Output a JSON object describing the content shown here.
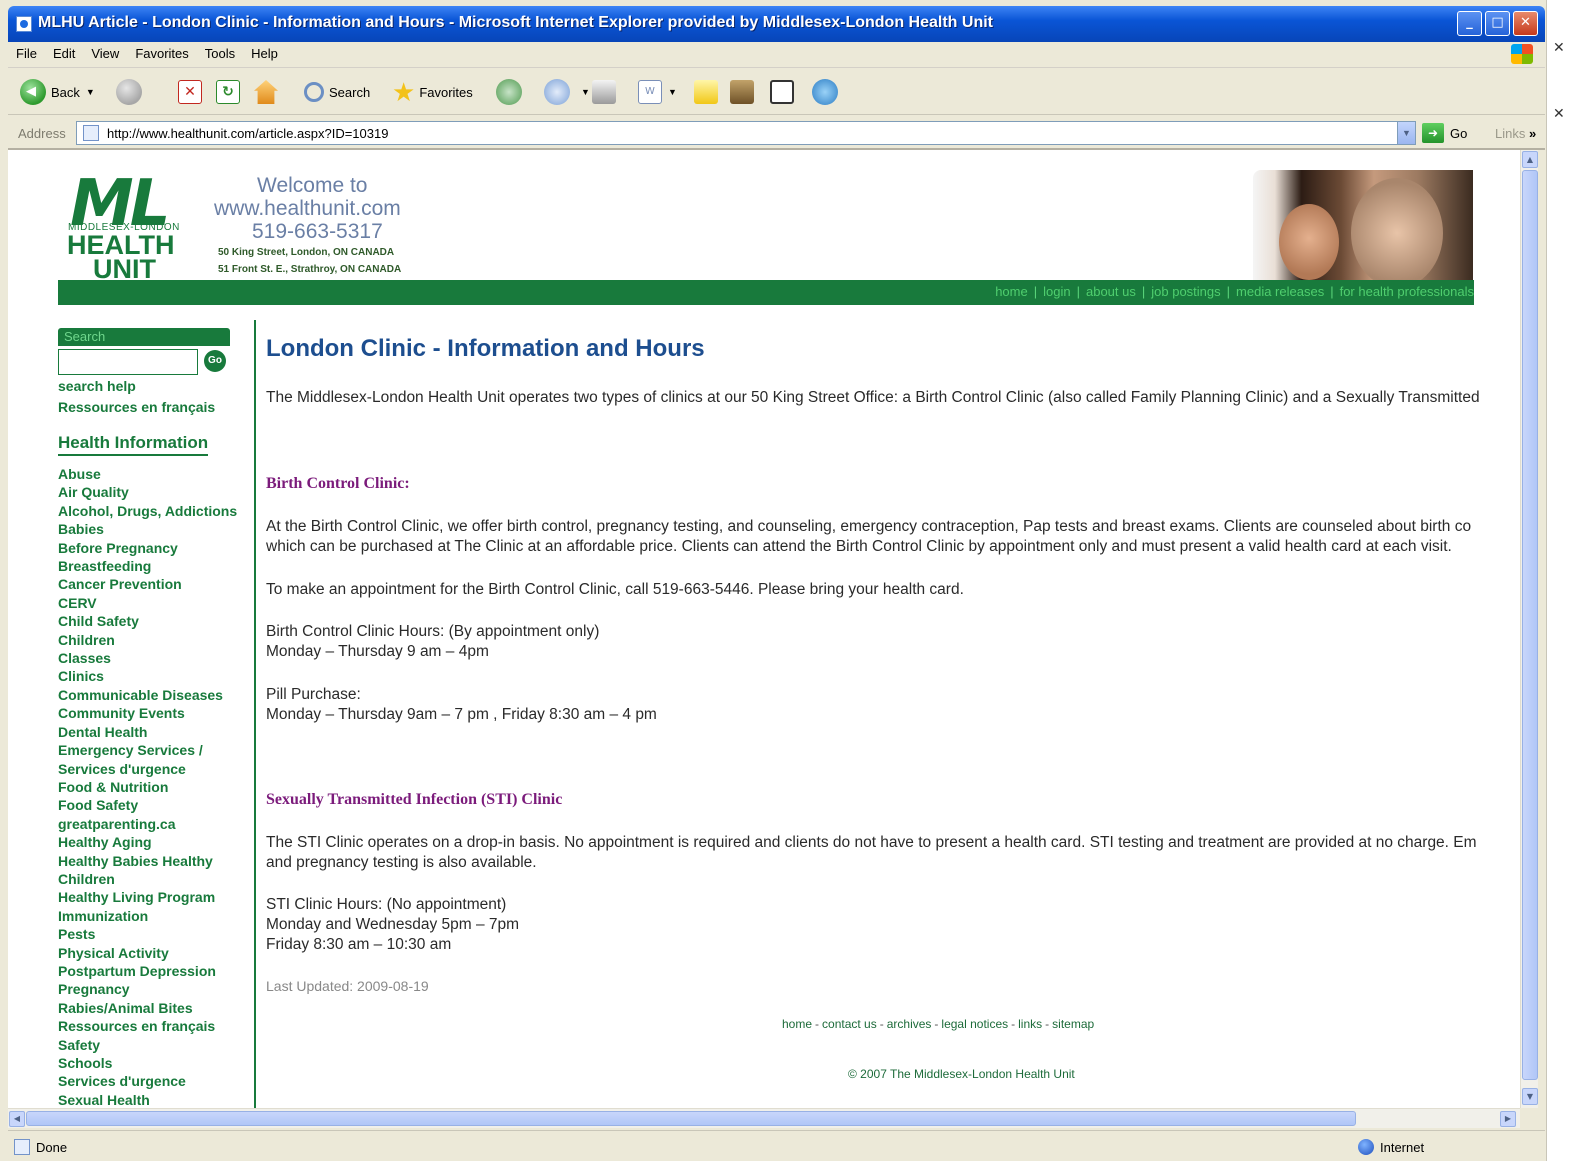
{
  "window": {
    "title": "MLHU Article - London Clinic - Information and Hours - Microsoft Internet Explorer provided by Middlesex-London Health Unit",
    "controls": [
      "_",
      "□",
      "✕"
    ]
  },
  "menu": [
    "File",
    "Edit",
    "View",
    "Favorites",
    "Tools",
    "Help"
  ],
  "toolbar": {
    "back": "Back",
    "search": "Search",
    "favorites": "Favorites"
  },
  "address": {
    "label": "Address",
    "url": "http://www.healthunit.com/article.aspx?ID=10319",
    "go": "Go",
    "links": "Links"
  },
  "header": {
    "logo_ml": "ML",
    "logo_sub": "MIDDLESEX-LONDON",
    "logo_health": "HEALTH",
    "logo_unit": "UNIT",
    "welcome": "Welcome to",
    "site": "www.healthunit.com",
    "phone": "519-663-5317",
    "address1": "50 King Street, London, ON  CANADA",
    "address2": "51 Front St. E., Strathroy, ON  CANADA",
    "nav": [
      "home",
      "login",
      "about us",
      "job postings",
      "media releases",
      "for health professionals"
    ]
  },
  "sidebar": {
    "search_label": "Search",
    "go_label": "Go",
    "search_help": "search help",
    "french": "Ressources en français",
    "health_info_heading": "Health Information",
    "items": [
      "Abuse",
      "Air Quality",
      "Alcohol, Drugs, Addictions",
      "Babies",
      "Before Pregnancy",
      "Breastfeeding",
      "Cancer Prevention",
      "CERV",
      "Child Safety",
      "Children",
      "Classes",
      "Clinics",
      "Communicable Diseases",
      "Community Events",
      "Dental Health",
      "Emergency Services /",
      "Services d'urgence",
      "Food & Nutrition",
      "Food Safety",
      "greatparenting.ca",
      "Healthy Aging",
      "Healthy Babies Healthy",
      "Children",
      "Healthy Living Program",
      "Immunization",
      "Pests",
      "Physical Activity",
      "Postpartum Depression",
      "Pregnancy",
      "Rabies/Animal Bites",
      "Ressources en français",
      "Safety",
      "Schools",
      "Services d'urgence",
      "Sexual Health"
    ]
  },
  "article": {
    "title": "London Clinic - Information and Hours",
    "intro": "The Middlesex-London Health Unit operates two types of clinics at our 50 King Street Office: a Birth Control Clinic (also called Family Planning Clinic) and a Sexually Transmitted",
    "bc_heading": "Birth Control Clinic:",
    "bc_p1_line1": "At the Birth Control Clinic, we offer birth control, pregnancy testing, and counseling, emergency contraception, Pap tests and breast exams.  Clients are counseled about birth co",
    "bc_p1_line2": "which can be purchased at The Clinic at an affordable price.  Clients can attend the Birth Control Clinic by appointment only and must present a valid health card at each visit.",
    "bc_p2": "To make an appointment for the Birth Control Clinic, call 519-663-5446.  Please bring your health card.",
    "bc_hours_label": "Birth Control Clinic Hours: (By appointment only)",
    "bc_hours": "Monday – Thursday 9 am – 4pm",
    "pill_label": "Pill Purchase:",
    "pill_hours": "Monday – Thursday 9am – 7 pm , Friday 8:30 am – 4 pm",
    "sti_heading": "Sexually Transmitted Infection (STI) Clinic",
    "sti_p1_line1": "The STI Clinic operates on a drop-in basis.  No appointment is required and clients do not have to present a health card.  STI testing and treatment are provided at no charge.  Em",
    "sti_p1_line2": "and pregnancy testing is also available.",
    "sti_hours_label": "STI Clinic Hours: (No appointment)",
    "sti_hours1": "Monday and Wednesday 5pm – 7pm",
    "sti_hours2": "Friday 8:30 am – 10:30 am",
    "last_updated": "Last Updated: 2009-08-19"
  },
  "footer": {
    "links": [
      "home",
      "contact us",
      "archives",
      "legal notices",
      "links",
      "sitemap"
    ],
    "copyright": "© 2007 The Middlesex-London Health Unit"
  },
  "status": {
    "left": "Done",
    "zone": "Internet"
  }
}
